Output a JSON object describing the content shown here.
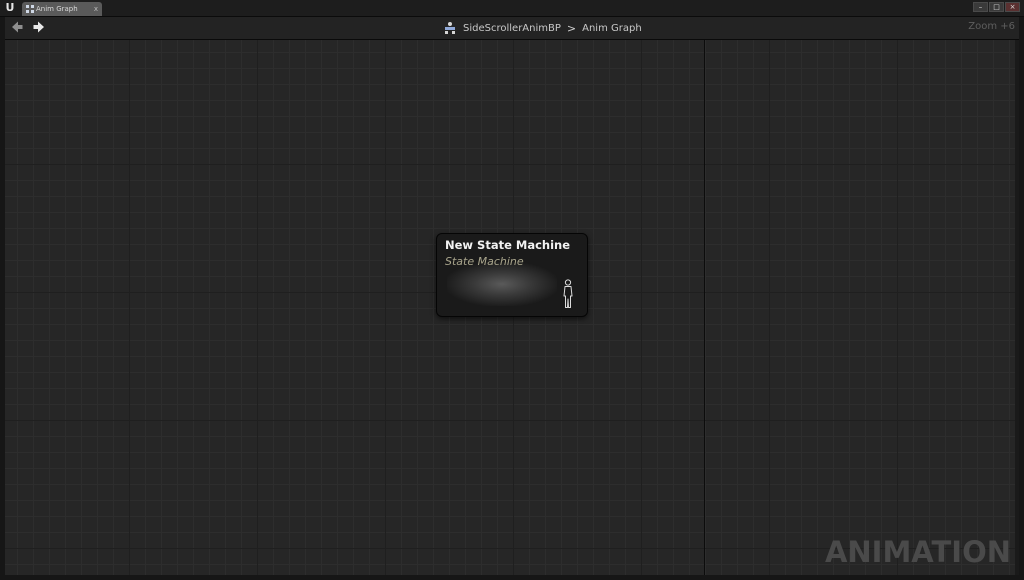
{
  "window": {
    "logo": "U",
    "tab_label": "Anim Graph",
    "tab_close": "x",
    "controls": {
      "minimize": "–",
      "maximize": "□",
      "close": "×"
    }
  },
  "navbar": {
    "breadcrumb": [
      "SideScrollerAnimBP",
      "Anim Graph"
    ],
    "separator": ">",
    "zoom": "Zoom +6"
  },
  "graph": {
    "node": {
      "title": "New State Machine",
      "subtitle": "State Machine",
      "icon": "person-icon"
    },
    "watermark": "ANIMATION"
  },
  "colors": {
    "graph_background": "#262626",
    "node_subtitle": "#a9a58c",
    "watermark": "#4a4a4a"
  }
}
